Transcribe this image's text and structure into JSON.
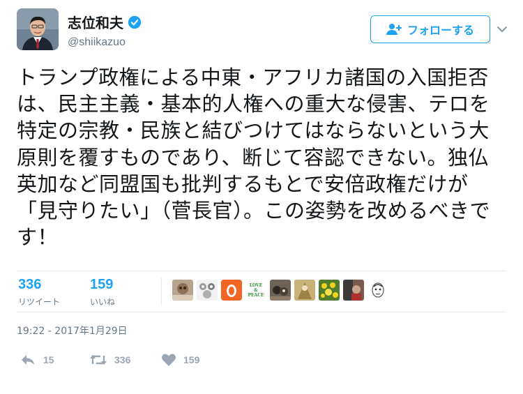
{
  "user": {
    "display_name": "志位和夫",
    "handle": "@shiikazuo",
    "verified": true,
    "avatar_icon": "person-avatar-icon"
  },
  "follow_button": {
    "label": "フォローする",
    "icon": "add-user-icon"
  },
  "menu_caret_icon": "chevron-down-icon",
  "tweet": {
    "text": "トランプ政権による中東・アフリカ諸国の入国拒否は、民主主義・基本的人権への重大な侵害、テロを特定の宗教・民族と結びつけてはならないという大原則を覆すものであり、断じて容認できない。独仏英加など同盟国も批判するもとで安倍政権だけが「見守りたい」（菅長官）。この姿勢を改めるべきです！",
    "timestamp": "19:22 - 2017年1月29日"
  },
  "stats": {
    "retweets": {
      "count": "336",
      "label": "リツイート"
    },
    "likes": {
      "count": "159",
      "label": "いいね"
    }
  },
  "likers": [
    {
      "name": "liker-avatar-1"
    },
    {
      "name": "liker-avatar-2"
    },
    {
      "name": "liker-avatar-3"
    },
    {
      "name": "liker-avatar-love-peace",
      "text1": "LOVE",
      "text2": "&",
      "text3": "PEACE"
    },
    {
      "name": "liker-avatar-5"
    },
    {
      "name": "liker-avatar-6"
    },
    {
      "name": "liker-avatar-7"
    },
    {
      "name": "liker-avatar-8"
    },
    {
      "name": "liker-avatar-9"
    }
  ],
  "actions": {
    "reply": {
      "icon": "reply-icon",
      "count": "15"
    },
    "retweet": {
      "icon": "retweet-icon",
      "count": "336"
    },
    "like": {
      "icon": "heart-icon",
      "count": "159"
    }
  },
  "colors": {
    "accent": "#1da1f2",
    "muted": "#657786",
    "action_gray": "#9aa7b2",
    "orange": "#f26522"
  }
}
